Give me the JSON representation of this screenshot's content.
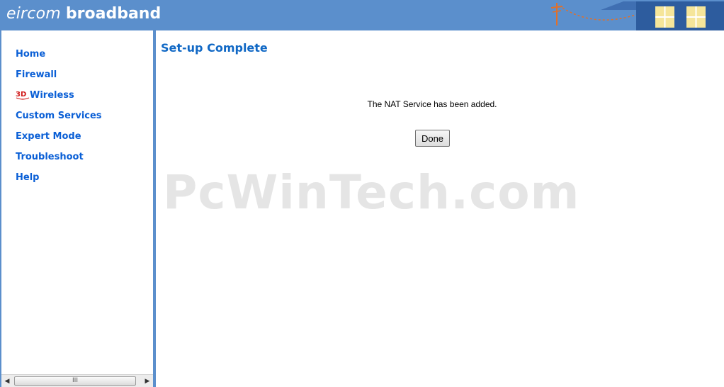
{
  "header": {
    "brand_light": "eircom",
    "brand_bold": "broadband"
  },
  "nav": {
    "items": [
      {
        "label": "Home",
        "icon": null
      },
      {
        "label": "Firewall",
        "icon": null
      },
      {
        "label": "Wireless",
        "icon": "3d-badge-icon"
      },
      {
        "label": "Custom Services",
        "icon": null
      },
      {
        "label": "Expert Mode",
        "icon": null
      },
      {
        "label": "Troubleshoot",
        "icon": null
      },
      {
        "label": "Help",
        "icon": null
      }
    ],
    "scrollbar_grip": "III"
  },
  "main": {
    "title": "Set-up Complete",
    "message": "The NAT Service has been added.",
    "done_label": "Done"
  },
  "watermark": "PcWinTech.com",
  "colors": {
    "banner": "#5b8fcc",
    "nav_link": "#0a5fd6",
    "title": "#1068c5"
  }
}
